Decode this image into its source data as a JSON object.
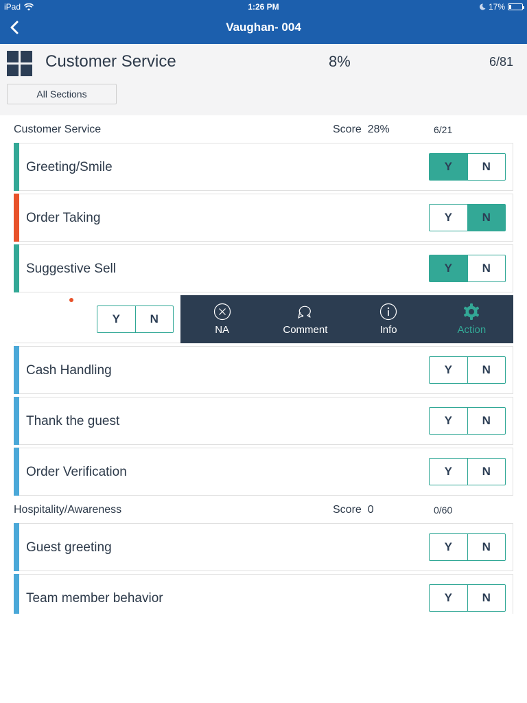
{
  "status_bar": {
    "device": "iPad",
    "time": "1:26 PM",
    "battery": "17%",
    "icons": [
      "wifi-icon",
      "moon-icon",
      "battery-icon"
    ]
  },
  "nav": {
    "title": "Vaughan- 004",
    "back_icon": "chevron-left-icon"
  },
  "header": {
    "icon": "grid-icon",
    "title": "Customer Service",
    "percent": "8%",
    "count": "6/81",
    "all_sections_label": "All Sections"
  },
  "colors": {
    "nav_blue": "#1c5fad",
    "teal": "#33a896",
    "orange": "#e8522a",
    "blue": "#4aa8d8",
    "dark_navy": "#2c3d51"
  },
  "sections": [
    {
      "name": "Customer Service",
      "score_label": "Score",
      "score": "28%",
      "fraction": "6/21",
      "items": [
        {
          "label": "Greeting/Smile",
          "status": "teal",
          "selected": "Y"
        },
        {
          "label": "Order Taking",
          "status": "orange",
          "selected": "N"
        },
        {
          "label": "Suggestive Sell",
          "status": "teal",
          "selected": "Y"
        },
        {
          "label": "",
          "status": "swiped",
          "selected": "",
          "flag": "orange-dot"
        },
        {
          "label": "Cash Handling",
          "status": "blue",
          "selected": ""
        },
        {
          "label": "Thank the guest",
          "status": "blue",
          "selected": ""
        },
        {
          "label": "Order Verification",
          "status": "blue",
          "selected": ""
        }
      ]
    },
    {
      "name": "Hospitality/Awareness",
      "score_label": "Score",
      "score": "0",
      "fraction": "0/60",
      "items": [
        {
          "label": "Guest greeting",
          "status": "blue",
          "selected": ""
        },
        {
          "label": "Team member behavior",
          "status": "blue",
          "selected": ""
        }
      ]
    }
  ],
  "yn": {
    "yes": "Y",
    "no": "N"
  },
  "swipe_actions": [
    {
      "label": "NA",
      "icon": "close-circle-icon",
      "active": false
    },
    {
      "label": "Comment",
      "icon": "comment-bubbles-icon",
      "active": false
    },
    {
      "label": "Info",
      "icon": "info-circle-icon",
      "active": false
    },
    {
      "label": "Action",
      "icon": "gear-icon",
      "active": true
    }
  ]
}
